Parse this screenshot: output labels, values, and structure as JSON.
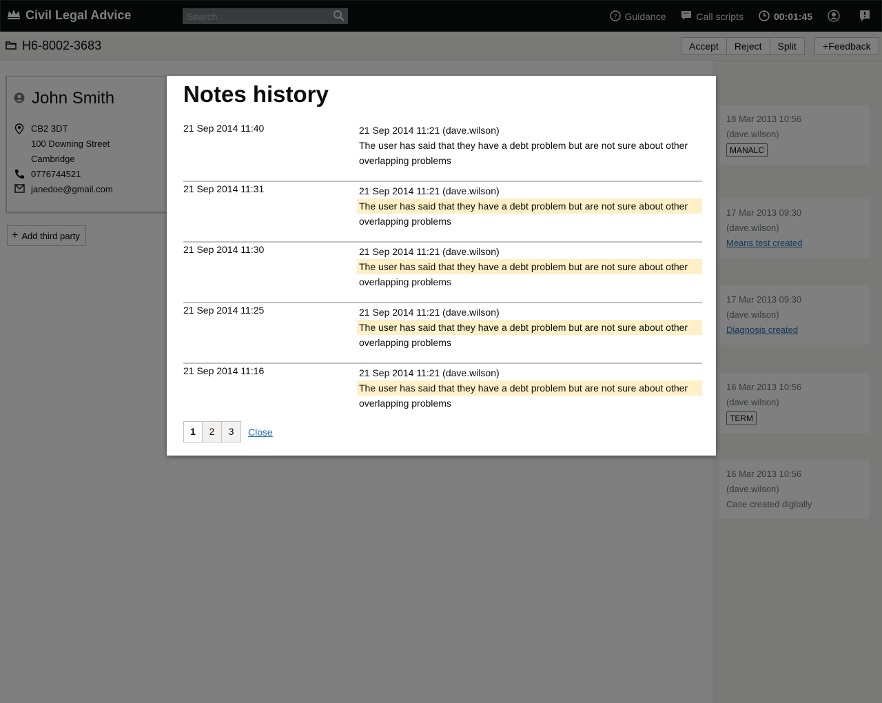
{
  "header": {
    "brand": "Civil Legal Advice",
    "search_placeholder": "Search",
    "guidance": "Guidance",
    "call_scripts": "Call scripts",
    "timer": "00:01:45"
  },
  "case": {
    "reference": "H6-8002-3683",
    "actions": [
      "Accept",
      "Reject",
      "Split"
    ],
    "feedback": "+Feedback"
  },
  "person": {
    "name": "John Smith",
    "postcode": "CB2 3DT",
    "street": "100 Downing Street",
    "city": "Cambridge",
    "phone": "0776744521",
    "email": "janedoe@gmail.com",
    "add_third_party": "Add third party"
  },
  "timeline": [
    {
      "date": "18 Mar 2013 10:56",
      "user": "(dave.wilson)",
      "tag": "MANALC"
    },
    {
      "date": "17 Mar 2013 09:30",
      "user": "(dave.wilson)",
      "link": "Means test created"
    },
    {
      "date": "17 Mar 2013 09:30",
      "user": "(dave.wilson)",
      "link": "Diagnosis created"
    },
    {
      "date": "16 Mar 2013 10:56",
      "user": "(dave.wilson)",
      "tag": "TERM"
    },
    {
      "date": "16 Mar 2013 10:56",
      "user": "(dave.wilson)",
      "text": "Case created digitally"
    }
  ],
  "modal": {
    "title": "Notes history",
    "notes": [
      {
        "date": "21 Sep 2014 11:40",
        "meta": "21 Sep 2014 11:21 (dave.wilson)",
        "line1": "The user has said that they have a debt problem but are not sure about other",
        "line2": "overlapping problems"
      },
      {
        "date": "21 Sep 2014 11:31",
        "meta": "21 Sep 2014 11:21 (dave.wilson)",
        "line1": "The user has said that they have a debt problem but are not sure about other",
        "line2": "overlapping problems"
      },
      {
        "date": "21 Sep 2014 11:30",
        "meta": "21 Sep 2014 11:21 (dave.wilson)",
        "line1": "The user has said that they have a debt problem but are not sure about other",
        "line2": "overlapping problems"
      },
      {
        "date": "21 Sep 2014 11:25",
        "meta": "21 Sep 2014 11:21 (dave.wilson)",
        "line1": "The user has said that they have a debt problem but are not sure about other",
        "line2": "overlapping problems"
      },
      {
        "date": "21 Sep 2014 11:16",
        "meta": "21 Sep 2014 11:21 (dave.wilson)",
        "line1": "The user has said that they have a debt problem but are not sure about other",
        "line2": "overlapping problems"
      }
    ],
    "pages": [
      "1",
      "2",
      "3"
    ],
    "close": "Close"
  },
  "colors": {
    "header_bg": "#0b0c0c",
    "link": "#1d70b8",
    "highlight": "#fff0c8"
  }
}
